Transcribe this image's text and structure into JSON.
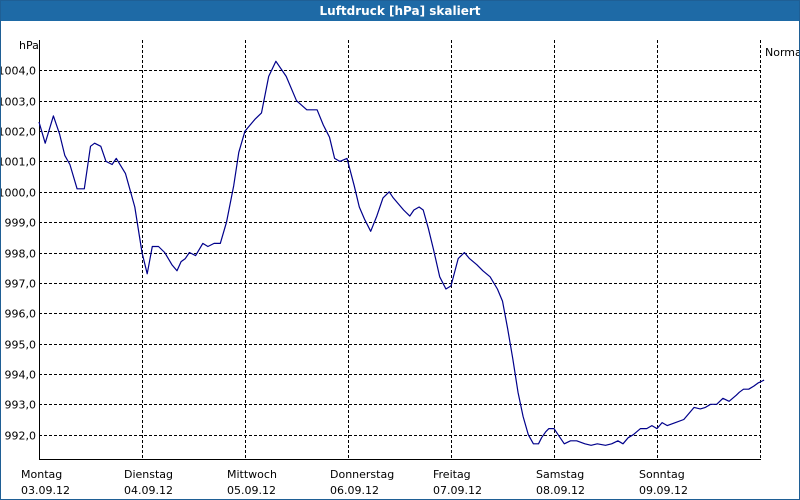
{
  "window": {
    "title": "Luftdruck [hPa] skaliert"
  },
  "chart_data": {
    "type": "line",
    "title": "Luftdruck [hPa] skaliert",
    "ylabel": "hPa",
    "xlabel": "",
    "ylim": [
      991.2,
      1005.0
    ],
    "yticks": [
      1004.0,
      1003.0,
      1002.0,
      1001.0,
      1000.0,
      999.0,
      998.0,
      997.0,
      996.0,
      995.0,
      994.0,
      993.0,
      992.0
    ],
    "ytick_labels": [
      "1004,0",
      "1003,0",
      "1002,0",
      "1001,0",
      "1000,0",
      "999,0",
      "998,0",
      "997,0",
      "996,0",
      "995,0",
      "994,0",
      "993,0",
      "992,0"
    ],
    "x_tick_labels": [
      {
        "day": "Montag",
        "date": "03.09.12"
      },
      {
        "day": "Dienstag",
        "date": "04.09.12"
      },
      {
        "day": "Mittwoch",
        "date": "05.09.12"
      },
      {
        "day": "Donnerstag",
        "date": "06.09.12"
      },
      {
        "day": "Freitag",
        "date": "07.09.12"
      },
      {
        "day": "Samstag",
        "date": "08.09.12"
      },
      {
        "day": "Sonntag",
        "date": "09.09.12"
      }
    ],
    "grid": true,
    "legend_position": "right",
    "series": [
      {
        "name": "Normal",
        "color": "#00008b",
        "x_days": [
          0,
          0.06,
          0.14,
          0.2,
          0.25,
          0.3,
          0.37,
          0.44,
          0.5,
          0.54,
          0.6,
          0.65,
          0.71,
          0.75,
          0.84,
          0.93,
          1.0,
          1.05,
          1.1,
          1.16,
          1.22,
          1.29,
          1.34,
          1.38,
          1.42,
          1.46,
          1.52,
          1.59,
          1.64,
          1.7,
          1.76,
          1.82,
          1.89,
          1.94,
          2.0,
          2.1,
          2.16,
          2.23,
          2.3,
          2.4,
          2.5,
          2.6,
          2.7,
          2.76,
          2.82,
          2.87,
          2.92,
          2.99,
          3.06,
          3.11,
          3.16,
          3.22,
          3.28,
          3.34,
          3.4,
          3.44,
          3.49,
          3.54,
          3.6,
          3.64,
          3.69,
          3.73,
          3.78,
          3.83,
          3.89,
          3.95,
          4.0,
          4.07,
          4.13,
          4.18,
          4.25,
          4.31,
          4.38,
          4.45,
          4.5,
          4.55,
          4.6,
          4.65,
          4.7,
          4.75,
          4.8,
          4.85,
          4.88,
          4.92,
          4.95,
          5.0,
          5.05,
          5.1,
          5.16,
          5.22,
          5.3,
          5.36,
          5.42,
          5.5,
          5.56,
          5.62,
          5.67,
          5.72,
          5.77,
          5.84,
          5.9,
          5.95,
          6.0,
          6.05,
          6.1,
          6.18,
          6.26,
          6.31,
          6.36,
          6.42,
          6.47,
          6.52,
          6.58,
          6.64,
          6.7,
          6.77,
          6.8,
          6.84,
          6.89,
          6.94,
          6.98,
          7.04
        ],
        "values": [
          1002.3,
          1001.6,
          1002.5,
          1001.9,
          1001.2,
          1000.9,
          1000.1,
          1000.1,
          1001.5,
          1001.6,
          1001.5,
          1001.0,
          1000.9,
          1001.1,
          1000.6,
          999.5,
          998.0,
          997.3,
          998.2,
          998.2,
          998.0,
          997.6,
          997.4,
          997.7,
          997.8,
          998.0,
          997.9,
          998.3,
          998.2,
          998.3,
          998.3,
          999.0,
          1000.2,
          1001.3,
          1002.0,
          1002.4,
          1002.6,
          1003.8,
          1004.3,
          1003.8,
          1003.0,
          1002.7,
          1002.7,
          1002.2,
          1001.8,
          1001.1,
          1001.0,
          1001.1,
          1000.2,
          999.5,
          999.1,
          998.7,
          999.2,
          999.8,
          1000.0,
          999.8,
          999.6,
          999.4,
          999.2,
          999.4,
          999.5,
          999.4,
          998.8,
          998.1,
          997.2,
          996.8,
          996.9,
          997.8,
          998.0,
          997.8,
          997.6,
          997.4,
          997.2,
          996.8,
          996.4,
          995.5,
          994.5,
          993.4,
          992.6,
          992.0,
          991.7,
          991.7,
          991.9,
          992.1,
          992.2,
          992.2,
          991.95,
          991.7,
          991.8,
          991.8,
          991.7,
          991.65,
          991.7,
          991.65,
          991.7,
          991.8,
          991.7,
          991.9,
          992.0,
          992.2,
          992.2,
          992.3,
          992.2,
          992.4,
          992.3,
          992.4,
          992.5,
          992.7,
          992.9,
          992.85,
          992.9,
          993.0,
          993.0,
          993.2,
          993.1,
          993.3,
          993.4,
          993.5,
          993.5,
          993.6,
          993.7,
          993.8
        ]
      }
    ]
  }
}
